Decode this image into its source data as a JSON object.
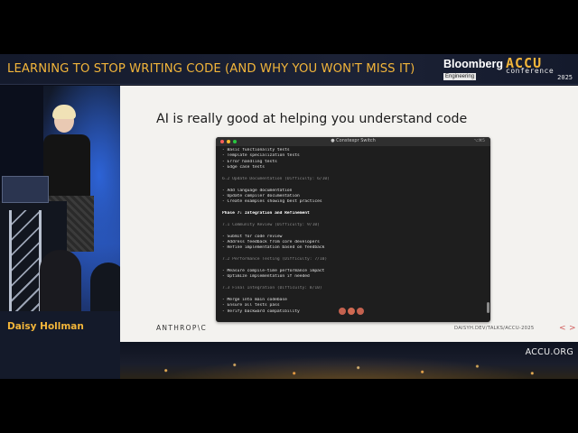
{
  "banner": {
    "talk_title": "LEARNING TO STOP WRITING CODE (AND WHY YOU WON'T MISS IT)",
    "sponsor_name": "Bloomberg",
    "sponsor_sub": "Engineering",
    "conf_word": "ACCU",
    "conf_sub": "conference",
    "conf_year": "2025"
  },
  "speaker": {
    "name": "Daisy Hollman"
  },
  "slide": {
    "title": "AI is really good at helping you understand code",
    "brand": "ANTHROP\\C",
    "url": "DAISYH.DEV/TALKS/ACCU-2025",
    "nav_prev": "<",
    "nav_next": ">"
  },
  "terminal": {
    "title": "● Constexpr Switch",
    "shortcut": "⌥⌘5",
    "lines": [
      {
        "text": "- Basic functionality tests",
        "style": "normal"
      },
      {
        "text": "- Template specialization tests",
        "style": "normal"
      },
      {
        "text": "- Error handling tests",
        "style": "normal"
      },
      {
        "text": "- Edge case tests",
        "style": "normal"
      },
      {
        "text": "",
        "style": "normal"
      },
      {
        "text": "6.2 Update Documentation (Difficulty: 6/10)",
        "style": "dim"
      },
      {
        "text": "",
        "style": "normal"
      },
      {
        "text": "- Add language documentation",
        "style": "normal"
      },
      {
        "text": "- Update compiler documentation",
        "style": "normal"
      },
      {
        "text": "- Create examples showing best practices",
        "style": "normal"
      },
      {
        "text": "",
        "style": "normal"
      },
      {
        "text": "Phase 7: Integration and Refinement",
        "style": "bold"
      },
      {
        "text": "",
        "style": "normal"
      },
      {
        "text": "7.1 Community Review (Difficulty: 9/10)",
        "style": "dim"
      },
      {
        "text": "",
        "style": "normal"
      },
      {
        "text": "- Submit for code review",
        "style": "normal"
      },
      {
        "text": "- Address feedback from core developers",
        "style": "normal"
      },
      {
        "text": "- Refine implementation based on feedback",
        "style": "normal"
      },
      {
        "text": "",
        "style": "normal"
      },
      {
        "text": "7.2 Performance Testing (Difficulty: 7/10)",
        "style": "dim"
      },
      {
        "text": "",
        "style": "normal"
      },
      {
        "text": "- Measure compile-time performance impact",
        "style": "normal"
      },
      {
        "text": "- Optimize implementation if needed",
        "style": "normal"
      },
      {
        "text": "",
        "style": "normal"
      },
      {
        "text": "7.3 Final Integration (Difficulty: 8/10)",
        "style": "dim"
      },
      {
        "text": "",
        "style": "normal"
      },
      {
        "text": "- Merge into main codebase",
        "style": "normal"
      },
      {
        "text": "- Ensure all tests pass",
        "style": "normal"
      },
      {
        "text": "- Verify backward compatibility",
        "style": "normal"
      }
    ]
  },
  "footer": {
    "site": "ACCU.ORG"
  }
}
